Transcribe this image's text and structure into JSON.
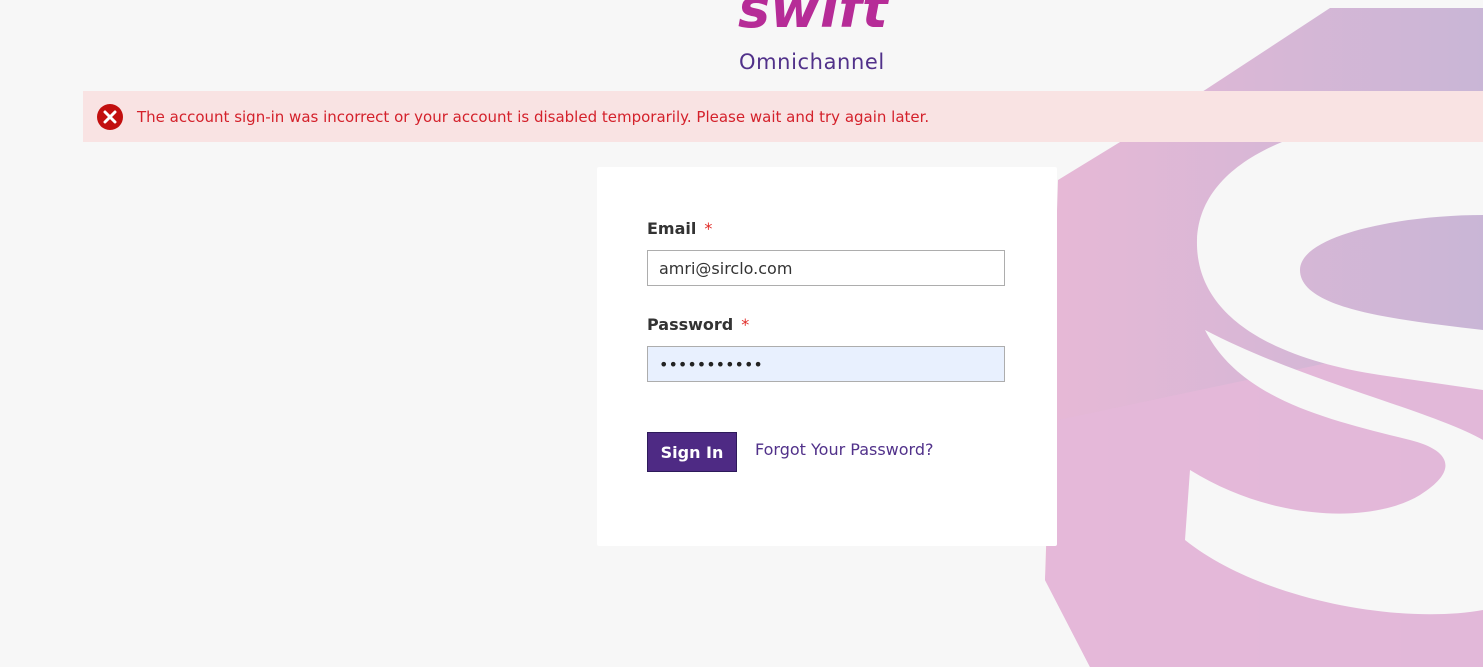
{
  "logo": {
    "word": "swift",
    "subtitle": "Omnichannel"
  },
  "error": {
    "icon": "close-circle-icon",
    "message": "The account sign-in was incorrect or your account is disabled temporarily. Please wait and try again later."
  },
  "form": {
    "email_label": "Email",
    "email_value": "amri@sirclo.com",
    "password_label": "Password",
    "password_masked": "•••••••••••",
    "required_marker": "*",
    "signin_label": "Sign In",
    "forgot_label": "Forgot Your Password?"
  },
  "colors": {
    "brand_magenta": "#b62c97",
    "brand_purple": "#51318a",
    "button": "#4e2a84",
    "error_bg": "#f9e3e3",
    "error_text": "#d4212b",
    "autofill_bg": "#e8f0fe"
  }
}
